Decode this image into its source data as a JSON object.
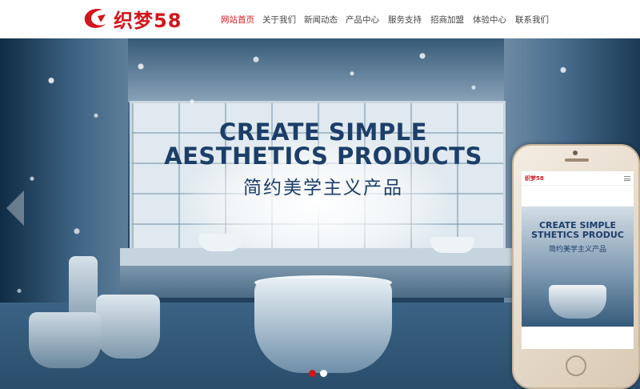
{
  "header": {
    "logo_text": "织梦58",
    "nav": [
      {
        "label": "网站首页",
        "active": true
      },
      {
        "label": "关于我们",
        "active": false
      },
      {
        "label": "新闻动态",
        "active": false
      },
      {
        "label": "产品中心",
        "active": false
      },
      {
        "label": "服务支持",
        "active": false
      },
      {
        "label": "招商加盟",
        "active": false
      },
      {
        "label": "体验中心",
        "active": false
      },
      {
        "label": "联系我们",
        "active": false
      }
    ]
  },
  "banner": {
    "headline_line1": "CREATE SIMPLE",
    "headline_line2": "AESTHETICS PRODUCTS",
    "headline_cn": "简约美学主义产品",
    "slide_count": 2,
    "active_slide": 1
  },
  "phone": {
    "logo_text": "织梦58",
    "headline_line1": "CREATE SIMPLE",
    "headline_line2": "STHETICS PRODUC",
    "headline_cn": "简约美学主义产品"
  },
  "colors": {
    "brand_red": "#d3151c",
    "headline_blue": "#1c3e68"
  },
  "icons": {
    "logo_mark": "crescent-c-logo",
    "prev": "triangle-left-arrow",
    "menu": "hamburger-icon"
  }
}
